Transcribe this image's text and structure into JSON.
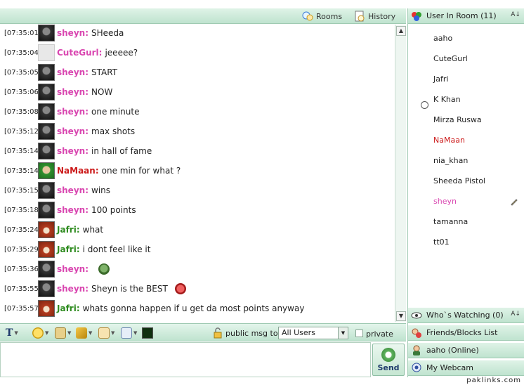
{
  "toolbar": {
    "rooms": "Rooms",
    "history": "History"
  },
  "messages": [
    {
      "time": "[07:35:01]",
      "nick": "sheyn",
      "color": "pink",
      "avatar": "dark",
      "text": "SHeeda"
    },
    {
      "time": "[07:35:04]",
      "nick": "CuteGurl",
      "color": "pink",
      "avatar": "grey",
      "text": "jeeeee?"
    },
    {
      "time": "[07:35:05]",
      "nick": "sheyn",
      "color": "pink",
      "avatar": "dark",
      "text": "START"
    },
    {
      "time": "[07:35:06]",
      "nick": "sheyn",
      "color": "pink",
      "avatar": "dark",
      "text": "NOW"
    },
    {
      "time": "[07:35:08]",
      "nick": "sheyn",
      "color": "pink",
      "avatar": "dark",
      "text": "one minute"
    },
    {
      "time": "[07:35:12]",
      "nick": "sheyn",
      "color": "pink",
      "avatar": "dark",
      "text": "max shots"
    },
    {
      "time": "[07:35:14]",
      "nick": "sheyn",
      "color": "pink",
      "avatar": "dark",
      "text": "in hall of fame"
    },
    {
      "time": "[07:35:14]",
      "nick": "NaMaan",
      "color": "red",
      "avatar": "green",
      "text": "one min for what ?"
    },
    {
      "time": "[07:35:15]",
      "nick": "sheyn",
      "color": "pink",
      "avatar": "dark",
      "text": "wins"
    },
    {
      "time": "[07:35:18]",
      "nick": "sheyn",
      "color": "pink",
      "avatar": "dark",
      "text": "100 points"
    },
    {
      "time": "[07:35:24]",
      "nick": "Jafri",
      "color": "green",
      "avatar": "red",
      "text": "what"
    },
    {
      "time": "[07:35:29]",
      "nick": "Jafri",
      "color": "green",
      "avatar": "red",
      "text": "i dont feel like it"
    },
    {
      "time": "[07:35:36]",
      "nick": "sheyn",
      "color": "pink",
      "avatar": "dark",
      "text": "",
      "emoticon": "frog"
    },
    {
      "time": "[07:35:55]",
      "nick": "sheyn",
      "color": "pink",
      "avatar": "dark",
      "text": "Sheyn is the BEST",
      "emoticon": "crab"
    },
    {
      "time": "[07:35:57]",
      "nick": "Jafri",
      "color": "green",
      "avatar": "red",
      "text": "whats gonna happen if u get da most points anyway"
    }
  ],
  "format_bar": {
    "public_msg_label": "public msg to:",
    "recipient": "All Users",
    "private_label": "private"
  },
  "input": {
    "send_label": "Send"
  },
  "room": {
    "header": "User In Room (11)",
    "users": [
      {
        "name": "aaho",
        "color": "normal"
      },
      {
        "name": "CuteGurl",
        "color": "normal"
      },
      {
        "name": "Jafri",
        "color": "normal"
      },
      {
        "name": "K Khan",
        "color": "normal",
        "away": true
      },
      {
        "name": "Mirza Ruswa",
        "color": "normal"
      },
      {
        "name": "NaMaan",
        "color": "red"
      },
      {
        "name": "nia_khan",
        "color": "normal"
      },
      {
        "name": "Sheeda Pistol",
        "color": "normal"
      },
      {
        "name": "sheyn",
        "color": "pink",
        "editing": true
      },
      {
        "name": "tamanna",
        "color": "normal"
      },
      {
        "name": "tt01",
        "color": "normal"
      }
    ]
  },
  "panels": {
    "watching": "Who`s Watching (0)",
    "friends": "Friends/Blocks List",
    "me": "aaho (Online)",
    "webcam": "My Webcam"
  },
  "footer": "paklinks.com"
}
